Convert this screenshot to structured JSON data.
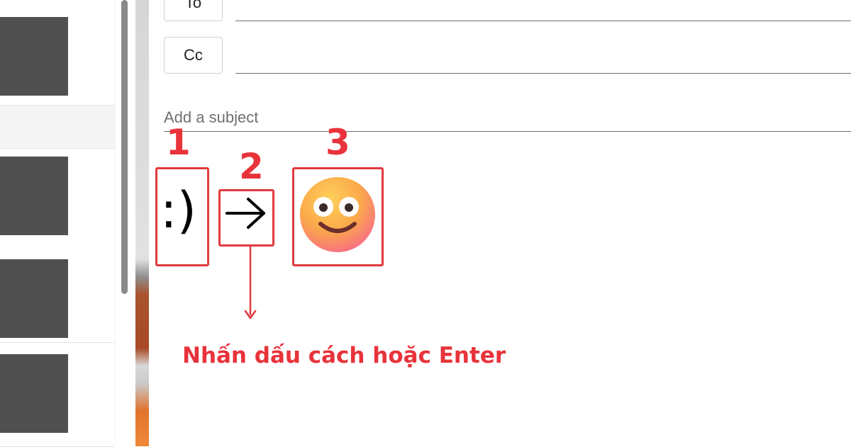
{
  "compose": {
    "to_label": "To",
    "cc_label": "Cc",
    "subject_placeholder": "Add a subject"
  },
  "annotations": {
    "step1": "1",
    "step2": "2",
    "step3": "3",
    "typed_text": ":)",
    "caption": "Nhấn dấu cách hoặc Enter",
    "accent_color": "#e8333a"
  },
  "icons": [
    "arrow-right-icon",
    "slightly-smiling-face-emoji",
    "arrow-down-icon"
  ]
}
